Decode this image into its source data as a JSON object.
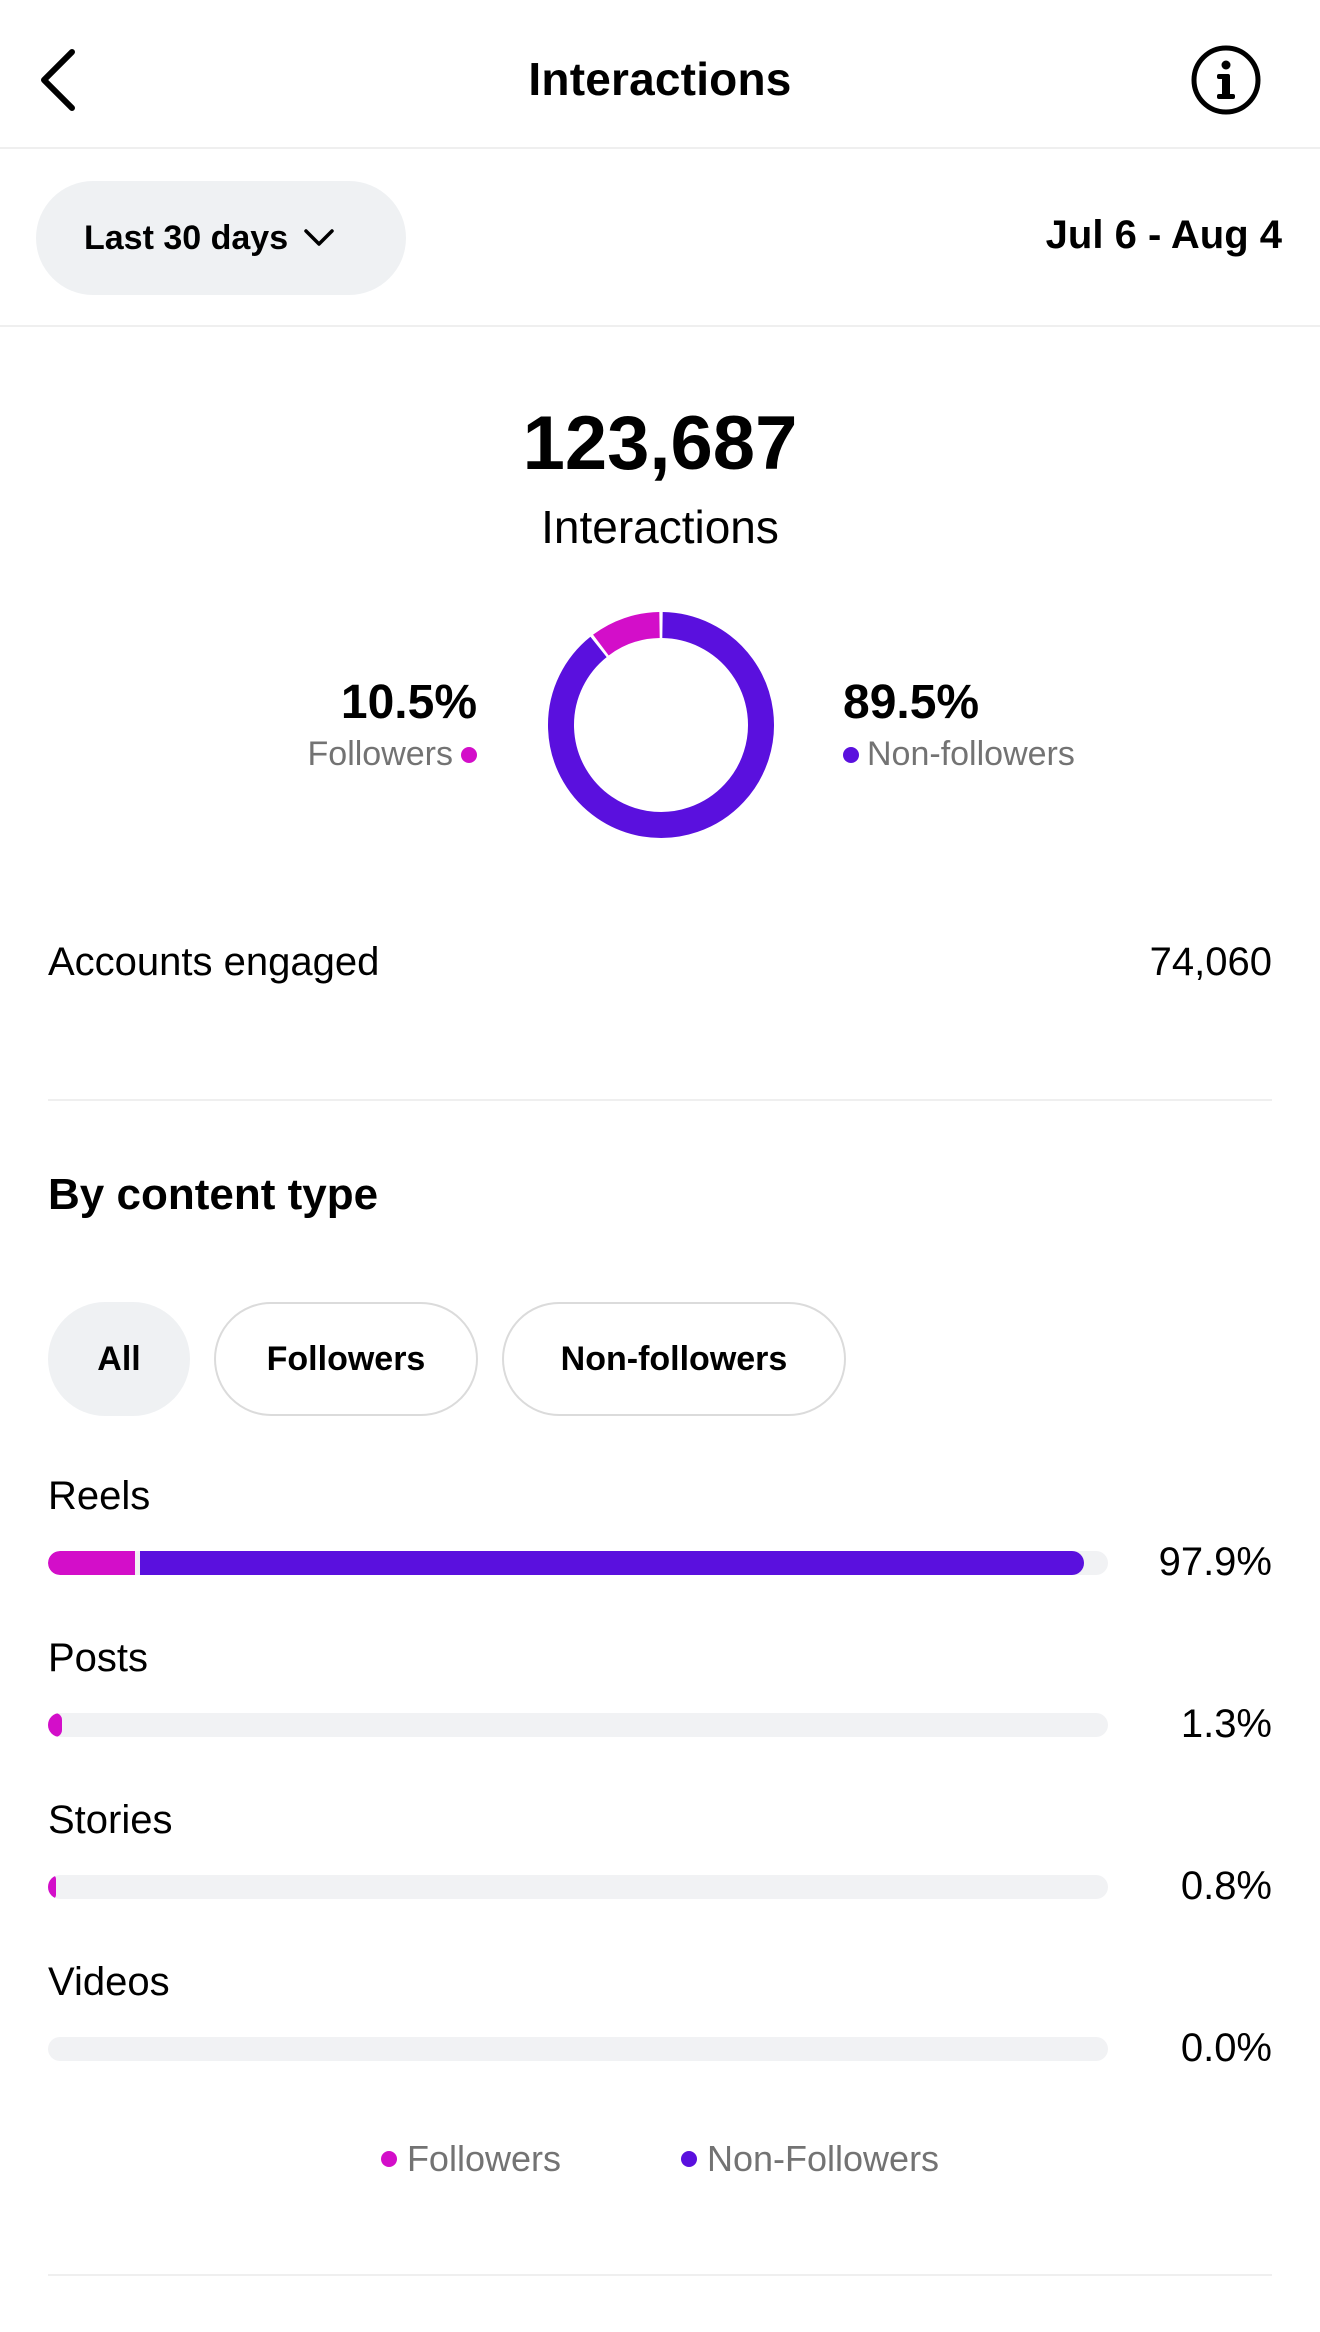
{
  "colors": {
    "followers": "#d30ec9",
    "non_followers": "#5a10de"
  },
  "header": {
    "title": "Interactions",
    "back_icon": "chevron-left-icon",
    "info_icon": "info-icon"
  },
  "filter": {
    "range_label": "Last 30 days",
    "date_range": "Jul 6 - Aug 4"
  },
  "summary": {
    "total": "123,687",
    "label": "Interactions",
    "followers_pct": "10.5%",
    "followers_label": "Followers",
    "non_followers_pct": "89.5%",
    "non_followers_label": "Non-followers"
  },
  "chart_data": {
    "type": "pie",
    "slices": [
      {
        "name": "Followers",
        "value": 10.5
      },
      {
        "name": "Non-followers",
        "value": 89.5
      }
    ]
  },
  "engaged": {
    "label": "Accounts engaged",
    "value": "74,060"
  },
  "content": {
    "title": "By content type",
    "chips": [
      "All",
      "Followers",
      "Non-followers"
    ],
    "rows": [
      {
        "label": "Reels",
        "pct": "97.9%",
        "followers_fraction": 0.082,
        "non_followers_fraction": 0.895
      },
      {
        "label": "Posts",
        "pct": "1.3%",
        "followers_fraction": 0.013,
        "non_followers_fraction": 0.0
      },
      {
        "label": "Stories",
        "pct": "0.8%",
        "followers_fraction": 0.008,
        "non_followers_fraction": 0.0
      },
      {
        "label": "Videos",
        "pct": "0.0%",
        "followers_fraction": 0.0,
        "non_followers_fraction": 0.0
      }
    ],
    "legend": [
      "Followers",
      "Non-Followers"
    ]
  }
}
